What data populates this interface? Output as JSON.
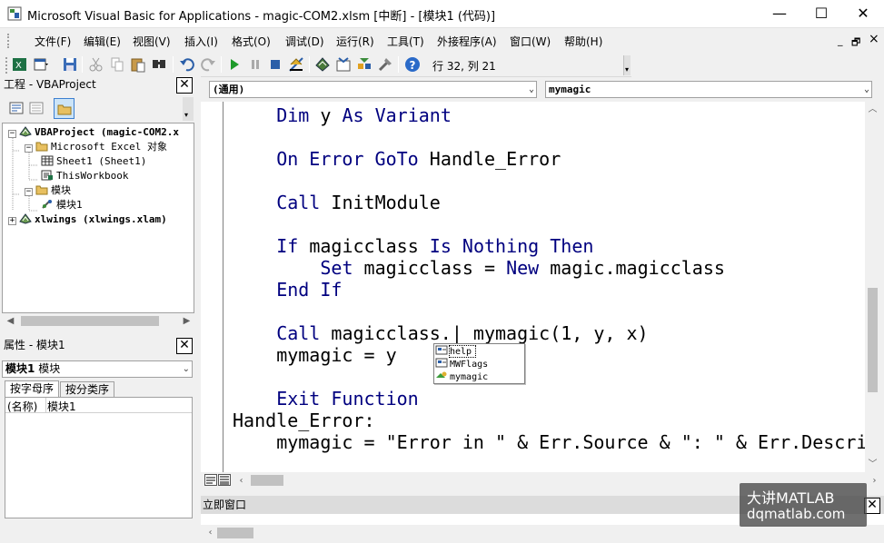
{
  "window": {
    "title": "Microsoft Visual Basic for Applications - magic-COM2.xlsm [中断] - [模块1 (代码)]",
    "minimize": "—",
    "maximize": "☐",
    "close": "✕"
  },
  "menu": {
    "items": [
      "文件(F)",
      "编辑(E)",
      "视图(V)",
      "插入(I)",
      "格式(O)",
      "调试(D)",
      "运行(R)",
      "工具(T)",
      "外接程序(A)",
      "窗口(W)",
      "帮助(H)"
    ],
    "mdi_minimize": "_",
    "mdi_restore": "🗗",
    "mdi_close": "×"
  },
  "toolbar": {
    "position": "行 32, 列 21",
    "icons": [
      "excel-icon",
      "insert-module-icon",
      "save-icon",
      "cut-icon",
      "copy-icon",
      "paste-icon",
      "find-icon",
      "undo-icon",
      "redo-icon",
      "run-icon",
      "break-icon",
      "reset-icon",
      "design-mode-icon",
      "project-explorer-icon",
      "properties-icon",
      "object-browser-icon",
      "toolbox-icon",
      "help-icon"
    ]
  },
  "project": {
    "title": "工程 - VBAProject",
    "close": "✕",
    "tree": [
      {
        "level": 0,
        "expander": "−",
        "icon": "vbaproject-icon",
        "text": "VBAProject (magic-COM2.x",
        "bold": true
      },
      {
        "level": 1,
        "expander": "−",
        "icon": "folder-icon",
        "text": "Microsoft Excel 对象",
        "bold": false
      },
      {
        "level": 2,
        "expander": "",
        "icon": "sheet-icon",
        "text": "Sheet1 (Sheet1)",
        "bold": false
      },
      {
        "level": 2,
        "expander": "",
        "icon": "workbook-icon",
        "text": "ThisWorkbook",
        "bold": false
      },
      {
        "level": 1,
        "expander": "−",
        "icon": "folder-icon",
        "text": "模块",
        "bold": false
      },
      {
        "level": 2,
        "expander": "",
        "icon": "module-icon",
        "text": "模块1",
        "bold": false
      },
      {
        "level": 0,
        "expander": "+",
        "icon": "vbaproject-icon",
        "text": "xlwings (xlwings.xlam)",
        "bold": true
      }
    ]
  },
  "properties": {
    "title": "属性 - 模块1",
    "close": "✕",
    "object_name": "模块1",
    "object_type": "模块",
    "tabs": [
      "按字母序",
      "按分类序"
    ],
    "rows": [
      {
        "name": "(名称)",
        "value": "模块1"
      }
    ]
  },
  "code": {
    "object_combo": "(通用)",
    "proc_combo": "mymagic",
    "lines": [
      {
        "indent": 4,
        "segments": [
          {
            "t": "Dim",
            "k": true
          },
          {
            "t": " y ",
            "k": false
          },
          {
            "t": "As",
            "k": true
          },
          {
            "t": " ",
            "k": false
          },
          {
            "t": "Variant",
            "k": true
          }
        ]
      },
      {
        "indent": 0,
        "segments": []
      },
      {
        "indent": 4,
        "segments": [
          {
            "t": "On Error GoTo",
            "k": true
          },
          {
            "t": " Handle_Error",
            "k": false
          }
        ]
      },
      {
        "indent": 0,
        "segments": []
      },
      {
        "indent": 4,
        "segments": [
          {
            "t": "Call",
            "k": true
          },
          {
            "t": " InitModule",
            "k": false
          }
        ]
      },
      {
        "indent": 0,
        "segments": []
      },
      {
        "indent": 4,
        "segments": [
          {
            "t": "If",
            "k": true
          },
          {
            "t": " magicclass ",
            "k": false
          },
          {
            "t": "Is Nothing Then",
            "k": true
          }
        ]
      },
      {
        "indent": 8,
        "segments": [
          {
            "t": "Set",
            "k": true
          },
          {
            "t": " magicclass = ",
            "k": false
          },
          {
            "t": "New",
            "k": true
          },
          {
            "t": " magic.magicclass",
            "k": false
          }
        ]
      },
      {
        "indent": 4,
        "segments": [
          {
            "t": "End If",
            "k": true
          }
        ]
      },
      {
        "indent": 0,
        "segments": []
      },
      {
        "indent": 4,
        "segments": [
          {
            "t": "Call",
            "k": true
          },
          {
            "t": " magicclass.| mymagic(1, y, x)",
            "k": false
          }
        ]
      },
      {
        "indent": 4,
        "segments": [
          {
            "t": "mymagic = y",
            "k": false
          }
        ]
      },
      {
        "indent": 0,
        "segments": []
      },
      {
        "indent": 4,
        "segments": [
          {
            "t": "Exit Function",
            "k": true
          }
        ]
      },
      {
        "indent": 0,
        "segments": [
          {
            "t": "Handle_Error:",
            "k": false
          }
        ]
      },
      {
        "indent": 4,
        "segments": [
          {
            "t": "mymagic = \"Error in \" & Err.Source & \": \" & Err.Descri",
            "k": false
          }
        ]
      }
    ]
  },
  "autocomplete": {
    "items": [
      {
        "icon": "method-icon",
        "text": "help"
      },
      {
        "icon": "method-icon",
        "text": "MWFlags"
      },
      {
        "icon": "method-green-icon",
        "text": "mymagic"
      }
    ]
  },
  "immediate": {
    "title": "立即窗口",
    "close": "✕"
  },
  "watermark": {
    "line1": "大讲MATLAB",
    "line2": "dqmatlab.com"
  },
  "colors": {
    "keyword": "#00007f",
    "selection": "#0078d7"
  }
}
